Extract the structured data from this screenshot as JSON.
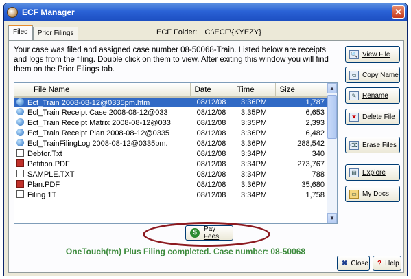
{
  "window": {
    "title": "ECF Manager"
  },
  "tabs": [
    {
      "label": "Filed",
      "active": true
    },
    {
      "label": "Prior Filings",
      "active": false
    }
  ],
  "ecf_folder": {
    "label": "ECF Folder:",
    "path": "C:\\ECF\\{KYEZY}"
  },
  "description": "Your case was filed and assigned case number 08-50068-Train. Listed below are receipts and logs from the filing. Double click on them to view. After exiting this window you will find them on the Prior Filings tab.",
  "table": {
    "columns": [
      "File Name",
      "Date",
      "Time",
      "Size"
    ],
    "rows": [
      {
        "icon": "web-file-icon",
        "name": "Ecf_Train 2008-08-12@0335pm.htm",
        "date": "08/12/08",
        "time": "3:36PM",
        "size": "1,787",
        "selected": true
      },
      {
        "icon": "web-file-icon",
        "name": "Ecf_Train Receipt Case 2008-08-12@033",
        "date": "08/12/08",
        "time": "3:35PM",
        "size": "6,653"
      },
      {
        "icon": "web-file-icon",
        "name": "Ecf_Train Receipt Matrix 2008-08-12@033",
        "date": "08/12/08",
        "time": "3:35PM",
        "size": "2,393"
      },
      {
        "icon": "web-file-icon",
        "name": "Ecf_Train Receipt Plan 2008-08-12@0335",
        "date": "08/12/08",
        "time": "3:36PM",
        "size": "6,482"
      },
      {
        "icon": "web-file-icon",
        "name": "Ecf_TrainFilingLog 2008-08-12@0335pm.",
        "date": "08/12/08",
        "time": "3:36PM",
        "size": "288,542"
      },
      {
        "icon": "text-file-icon",
        "name": "Debtor.Txt",
        "date": "08/12/08",
        "time": "3:34PM",
        "size": "340"
      },
      {
        "icon": "pdf-file-icon",
        "name": "Petition.PDF",
        "date": "08/12/08",
        "time": "3:34PM",
        "size": "273,767"
      },
      {
        "icon": "text-file-icon",
        "name": "SAMPLE.TXT",
        "date": "08/12/08",
        "time": "3:34PM",
        "size": "788"
      },
      {
        "icon": "pdf-file-icon",
        "name": "Plan.PDF",
        "date": "08/12/08",
        "time": "3:36PM",
        "size": "35,680"
      },
      {
        "icon": "text-file-icon",
        "name": "Filing 1T",
        "date": "08/12/08",
        "time": "3:34PM",
        "size": "1,758"
      }
    ]
  },
  "side_buttons": [
    {
      "label": "View File",
      "icon": "view-file-icon"
    },
    {
      "label": "Copy Name",
      "icon": "copy-icon"
    },
    {
      "label": "Rename",
      "icon": "rename-icon"
    },
    {
      "label": "Delete File",
      "icon": "delete-icon"
    },
    {
      "label": "Erase Files",
      "icon": "erase-icon"
    },
    {
      "label": "Explore",
      "icon": "explore-icon"
    },
    {
      "label": "My Docs",
      "icon": "folder-icon"
    }
  ],
  "pay_fees": {
    "label": "Pay Fees"
  },
  "status": "OneTouch(tm) Plus Filing completed. Case number: 08-50068",
  "bottom_buttons": {
    "close": "Close",
    "help": "Help"
  }
}
